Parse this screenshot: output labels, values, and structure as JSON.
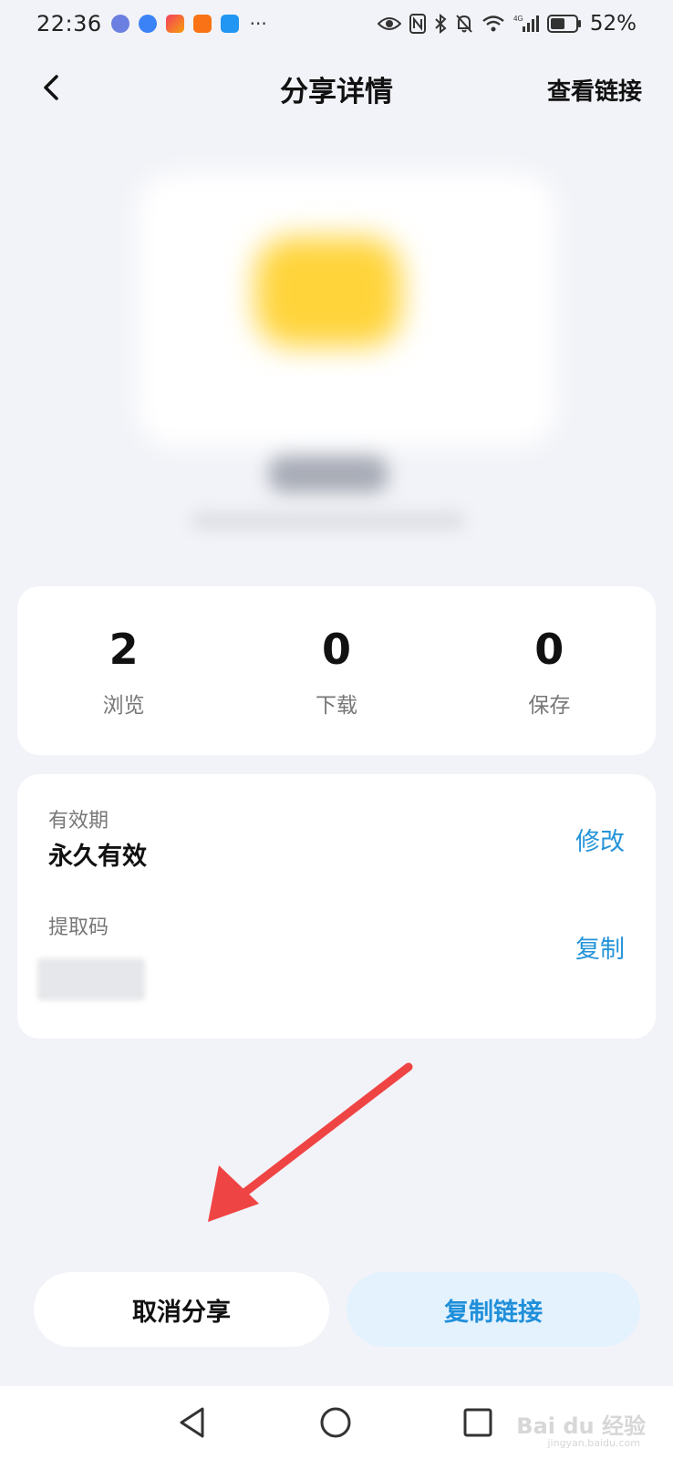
{
  "status_bar": {
    "time": "22:36",
    "more": "···",
    "network": "4G",
    "battery": "52%"
  },
  "header": {
    "title": "分享详情",
    "view_link": "查看链接",
    "back_icon": "chevron-left-icon"
  },
  "stats": [
    {
      "value": "2",
      "label": "浏览"
    },
    {
      "value": "0",
      "label": "下载"
    },
    {
      "value": "0",
      "label": "保存"
    }
  ],
  "info": {
    "validity_label": "有效期",
    "validity_value": "永久有效",
    "validity_action": "修改",
    "code_label": "提取码",
    "code_action": "复制"
  },
  "buttons": {
    "cancel_share": "取消分享",
    "copy_link": "复制链接"
  },
  "watermark": {
    "text": "Bai du 经验",
    "sub": "jingyan.baidu.com"
  },
  "colors": {
    "accent": "#2594d9",
    "copy_button_bg": "#e3f2fd",
    "arrow": "#ef4444",
    "background": "#f2f3f8"
  }
}
